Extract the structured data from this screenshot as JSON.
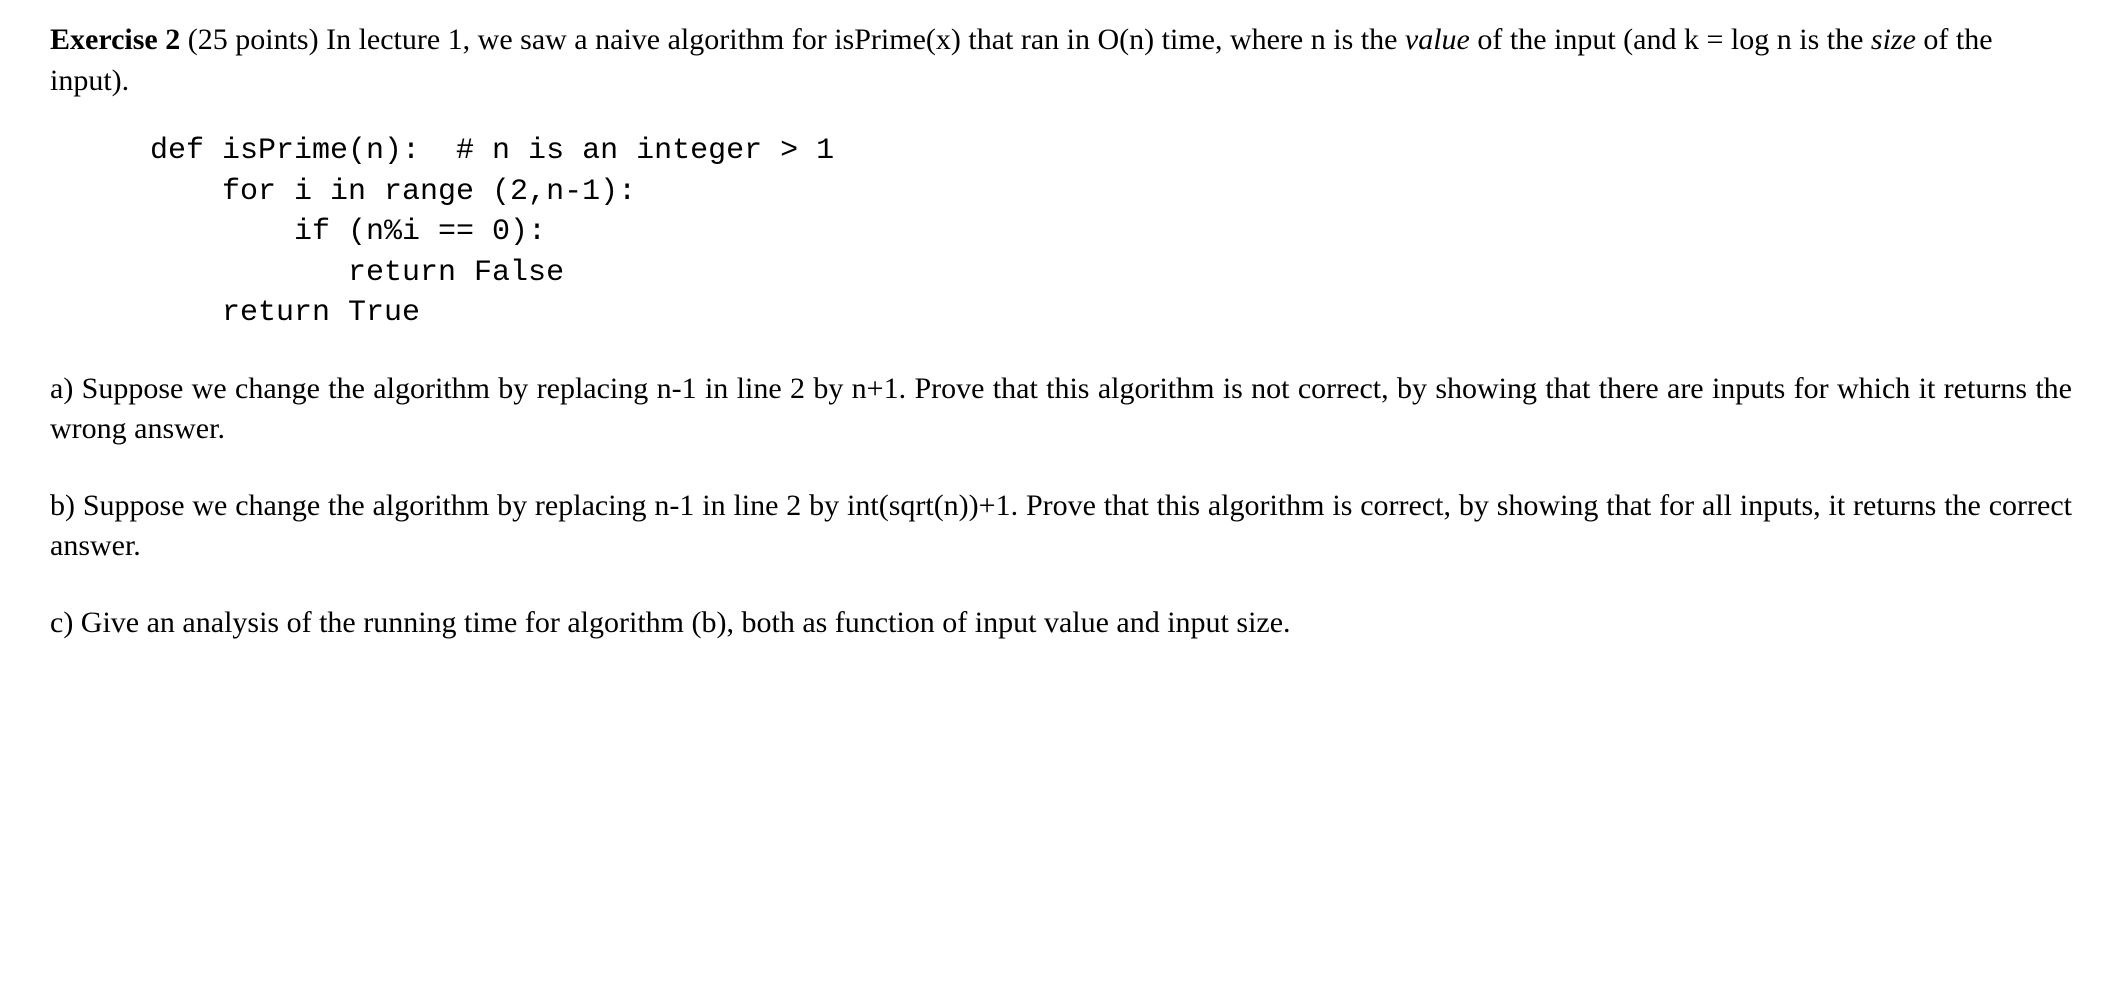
{
  "exercise": {
    "title_bold": "Exercise 2",
    "points": " (25 points) ",
    "intro_part1": "In lecture 1, we saw a naive algorithm for isPrime(x) that ran in O(n) time, where n is the ",
    "value_word": "value",
    "intro_part2": " of the input (and k = log n is the ",
    "size_word": "size",
    "intro_part3": " of the input)."
  },
  "code": {
    "line1": "def isPrime(n):  # n is an integer > 1",
    "line2": "    for i in range (2,n-1):",
    "line3": "        if (n%i == 0):",
    "line4": "           return False",
    "line5": "    return True"
  },
  "part_a": "a) Suppose we change the algorithm by replacing n-1 in line 2 by n+1.  Prove that this algorithm is not correct, by showing that there are inputs for which it returns the wrong answer.",
  "part_b": "b) Suppose we change the algorithm by replacing n-1 in line 2 by int(sqrt(n))+1. Prove that this algorithm is correct, by showing that for all inputs, it returns the correct answer.",
  "part_c": "c) Give an analysis of the running time for algorithm (b), both as function of input value and input size."
}
